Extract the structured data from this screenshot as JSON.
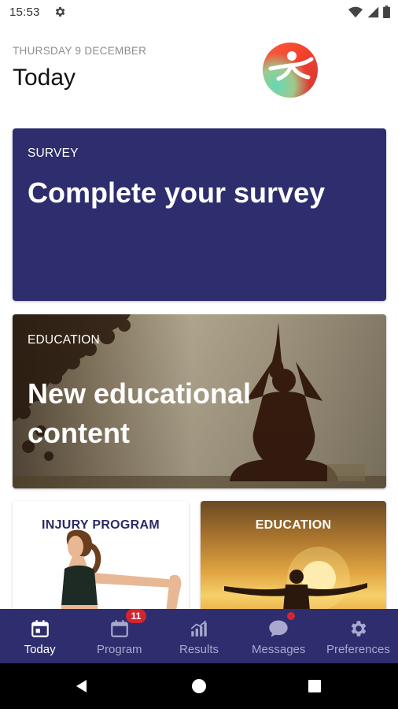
{
  "status_bar": {
    "time": "15:53",
    "icons": [
      "gear-icon",
      "wifi-icon",
      "signal-icon",
      "battery-icon"
    ]
  },
  "header": {
    "date": "THURSDAY 9 DECEMBER",
    "title": "Today"
  },
  "cards": {
    "survey": {
      "kicker": "SURVEY",
      "headline": "Complete your survey"
    },
    "education": {
      "kicker": "EDUCATION",
      "headline_line1": "New educational",
      "headline_line2": "content"
    },
    "injury": {
      "kicker": "INJURY PROGRAM"
    },
    "education_small": {
      "kicker": "EDUCATION"
    }
  },
  "bottom_nav": {
    "items": [
      {
        "label": "Today",
        "icon": "calendar-today-icon",
        "active": true
      },
      {
        "label": "Program",
        "icon": "calendar-icon",
        "badge": "11"
      },
      {
        "label": "Results",
        "icon": "bar-chart-icon"
      },
      {
        "label": "Messages",
        "icon": "chat-icon",
        "dot": true
      },
      {
        "label": "Preferences",
        "icon": "gear-icon"
      }
    ]
  },
  "colors": {
    "brand_navy": "#2e2d6d",
    "badge_red": "#d32530",
    "nav_inactive": "#a9a8cf"
  }
}
